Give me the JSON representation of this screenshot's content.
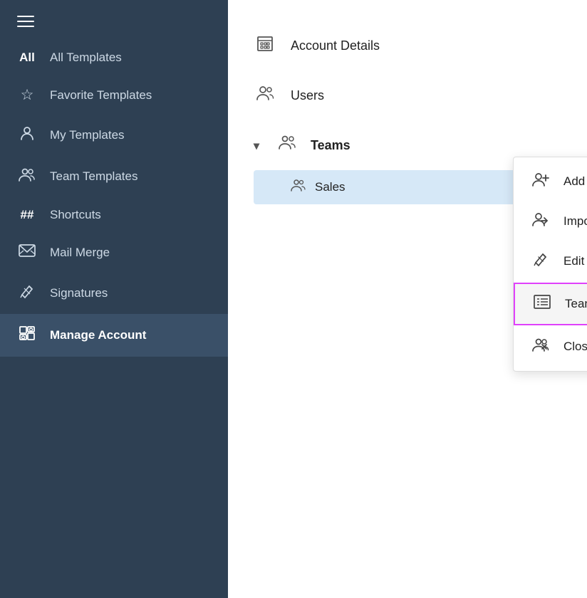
{
  "sidebar": {
    "hamburger_label": "Menu",
    "items": [
      {
        "id": "all-templates",
        "prefix": "All",
        "label": "All Templates",
        "icon": null
      },
      {
        "id": "favorite-templates",
        "prefix": null,
        "label": "Favorite Templates",
        "icon": "star"
      },
      {
        "id": "my-templates",
        "prefix": null,
        "label": "My Templates",
        "icon": "person"
      },
      {
        "id": "team-templates",
        "prefix": null,
        "label": "Team Templates",
        "icon": "people"
      },
      {
        "id": "shortcuts",
        "prefix": "##",
        "label": "Shortcuts",
        "icon": null
      },
      {
        "id": "mail-merge",
        "prefix": null,
        "label": "Mail Merge",
        "icon": "envelope"
      },
      {
        "id": "signatures",
        "prefix": null,
        "label": "Signatures",
        "icon": "pen"
      },
      {
        "id": "manage-account",
        "prefix": null,
        "label": "Manage Account",
        "icon": "settings",
        "active": true
      }
    ]
  },
  "main": {
    "manage_account_items": [
      {
        "id": "account-details",
        "label": "Account Details",
        "icon": "building"
      },
      {
        "id": "users",
        "label": "Users",
        "icon": "users"
      }
    ],
    "teams_section": {
      "label": "Teams",
      "chevron": "▾",
      "items": [
        {
          "id": "sales",
          "label": "Sales",
          "selected": true
        }
      ]
    },
    "context_menu": {
      "items": [
        {
          "id": "add-users",
          "label": "Add Users",
          "icon": "add-user"
        },
        {
          "id": "import-users",
          "label": "Import Users",
          "icon": "import-user"
        },
        {
          "id": "edit-team",
          "label": "Edit Team",
          "icon": "edit"
        },
        {
          "id": "team-properties",
          "label": "Team Properties",
          "icon": "properties",
          "highlighted": true
        },
        {
          "id": "close-team",
          "label": "Close Team",
          "icon": "close-team"
        }
      ]
    }
  }
}
